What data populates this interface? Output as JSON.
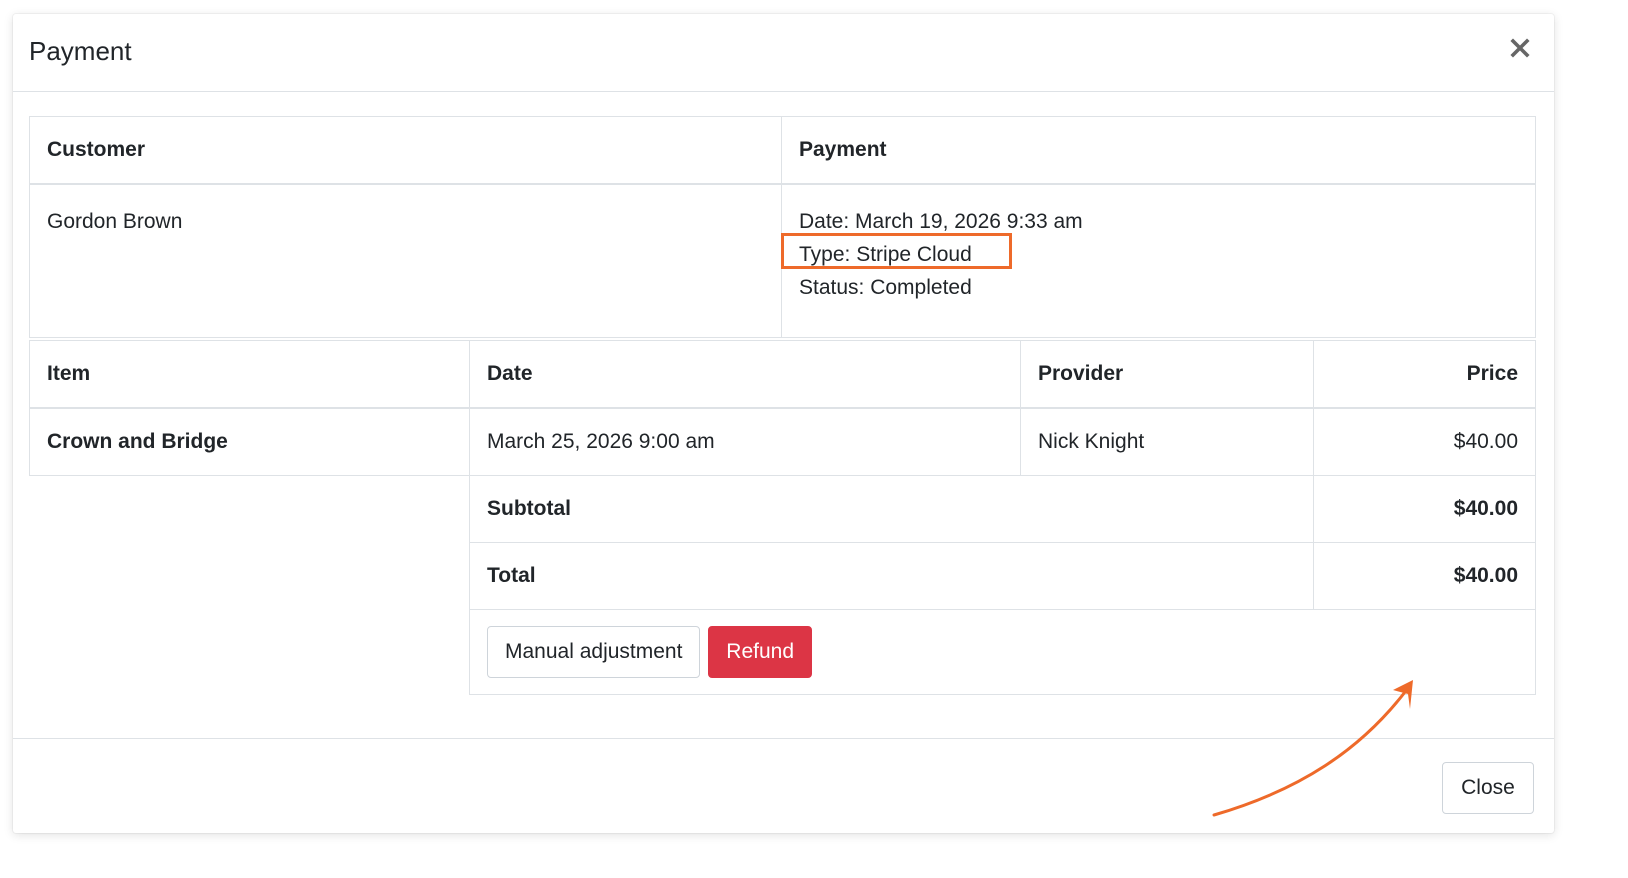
{
  "modal": {
    "title": "Payment",
    "close_icon": "close-icon"
  },
  "summary": {
    "headers": {
      "customer": "Customer",
      "payment": "Payment"
    },
    "customer_name": "Gordon Brown",
    "payment_date": "Date: March 19, 2026 9:33 am",
    "payment_type": "Type: Stripe Cloud",
    "payment_status": "Status: Completed"
  },
  "items": {
    "headers": {
      "item": "Item",
      "date": "Date",
      "provider": "Provider",
      "price": "Price"
    },
    "rows": [
      {
        "item": "Crown and Bridge",
        "date": "March 25, 2026 9:00 am",
        "provider": "Nick Knight",
        "price": "$40.00"
      }
    ],
    "subtotal_label": "Subtotal",
    "subtotal_value": "$40.00",
    "total_label": "Total",
    "total_value": "$40.00"
  },
  "actions": {
    "manual_adjustment_label": "Manual adjustment",
    "refund_label": "Refund"
  },
  "footer": {
    "close_label": "Close"
  },
  "colors": {
    "annotation_accent": "#ee6a2a",
    "danger": "#dc3545",
    "border": "#dee2e6",
    "text": "#212529"
  }
}
